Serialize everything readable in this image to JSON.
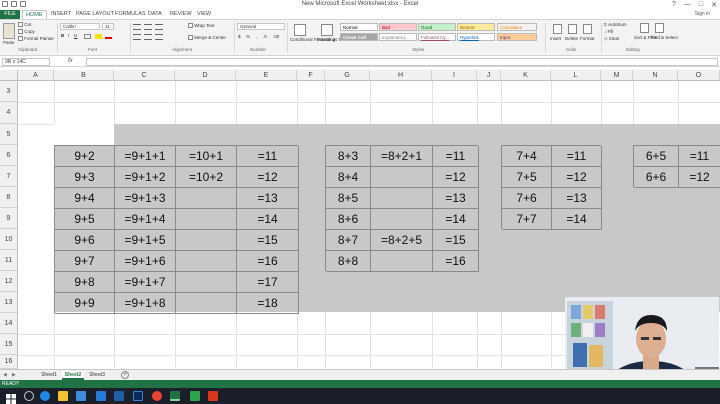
{
  "window": {
    "title": "New Microsoft Excel Worksheet.xlsx - Excel",
    "signin": "Sign in"
  },
  "tabs": [
    "FILE",
    "HOME",
    "INSERT",
    "PAGE LAYOUT",
    "FORMULAS",
    "DATA",
    "REVIEW",
    "VIEW"
  ],
  "ribbon": {
    "clipboard": {
      "paste": "Paste",
      "cut": "Cut",
      "copy": "Copy",
      "format_painter": "Format Painter",
      "label": "Clipboard"
    },
    "font": {
      "name": "Calibri",
      "size": "11",
      "label": "Font"
    },
    "alignment": {
      "wrap": "Wrap Text",
      "merge": "Merge & Center",
      "label": "Alignment"
    },
    "number": {
      "format": "General",
      "label": "Number"
    },
    "styles": {
      "cond": "Conditional Formatting",
      "table": "Format as Table",
      "normal": "Normal",
      "bad": "Bad",
      "good": "Good",
      "neutral": "Neutral",
      "calculation": "Calculation",
      "check_cell": "Check Cell",
      "explanatory": "Explanatory...",
      "followed": "Followed Hy...",
      "hyperlink": "Hyperlink",
      "input": "Input",
      "label": "Styles"
    },
    "cells": {
      "insert": "Insert",
      "delete": "Delete",
      "format": "Format",
      "label": "Cells"
    },
    "editing": {
      "autosum": "AutoSum",
      "fill": "Fill",
      "clear": "Clear",
      "sort": "Sort & Filter",
      "find": "Find & Select",
      "label": "Editing"
    }
  },
  "formula_bar": {
    "name_box": "9R x 14C",
    "fx": "fx",
    "value": ""
  },
  "columns": [
    "A",
    "B",
    "C",
    "D",
    "E",
    "F",
    "G",
    "H",
    "I",
    "J",
    "K",
    "L",
    "M",
    "N",
    "O"
  ],
  "rows": [
    "3",
    "4",
    "5",
    "6",
    "7",
    "8",
    "9",
    "10",
    "11",
    "12",
    "13",
    "14",
    "15",
    "16"
  ],
  "block1": [
    [
      "9+2",
      "=9+1+1",
      "=10+1",
      "=11"
    ],
    [
      "9+3",
      "=9+1+2",
      "=10+2",
      "=12"
    ],
    [
      "9+4",
      "=9+1+3",
      "",
      "=13"
    ],
    [
      "9+5",
      "=9+1+4",
      "",
      "=14"
    ],
    [
      "9+6",
      "=9+1+5",
      "",
      "=15"
    ],
    [
      "9+7",
      "=9+1+6",
      "",
      "=16"
    ],
    [
      "9+8",
      "=9+1+7",
      "",
      "=17"
    ],
    [
      "9+9",
      "=9+1+8",
      "",
      "=18"
    ]
  ],
  "block2": [
    [
      "8+3",
      "=8+2+1",
      "=11"
    ],
    [
      "8+4",
      "",
      "=12"
    ],
    [
      "8+5",
      "",
      "=13"
    ],
    [
      "8+6",
      "",
      "=14"
    ],
    [
      "8+7",
      "=8+2+5",
      "=15"
    ],
    [
      "8+8",
      "",
      "=16"
    ]
  ],
  "block3": [
    [
      "7+4",
      "=11"
    ],
    [
      "7+5",
      "=12"
    ],
    [
      "7+6",
      "=13"
    ],
    [
      "7+7",
      "=14"
    ]
  ],
  "block4": [
    [
      "6+5",
      "=11"
    ],
    [
      "6+6",
      "=12"
    ]
  ],
  "sheets": [
    "Sheet1",
    "Sheet2",
    "Sheet3"
  ],
  "active_sheet": "Sheet2",
  "status": {
    "ready": "READY"
  },
  "colors": {
    "excel_green": "#217346",
    "sheet_fill": "#c8c8c8"
  }
}
